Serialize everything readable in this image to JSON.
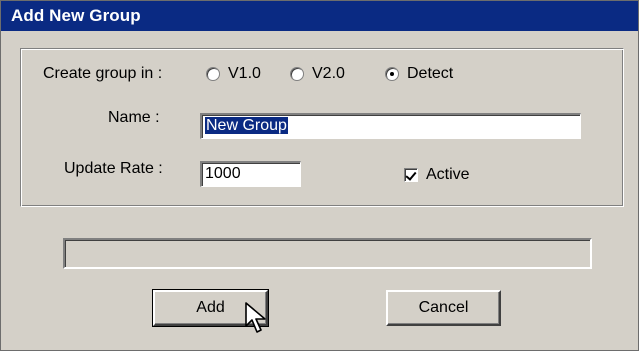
{
  "window": {
    "title": "Add New Group"
  },
  "form": {
    "create_group_label": "Create group in :",
    "radio_options": [
      {
        "label": "V1.0",
        "selected": false
      },
      {
        "label": "V2.0",
        "selected": false
      },
      {
        "label": "Detect",
        "selected": true
      }
    ],
    "name_label": "Name :",
    "name_value": "New Group",
    "update_rate_label": "Update Rate :",
    "update_rate_value": "1000",
    "active_label": "Active",
    "active_checked": true
  },
  "progress": {
    "value": 0
  },
  "buttons": {
    "add_label": "Add",
    "cancel_label": "Cancel"
  },
  "colors": {
    "titlebar": "#0a2a83",
    "dialog": "#d4d0c8",
    "selection": "#0a2a83"
  },
  "icons": {
    "cursor": "arrow-cursor-icon"
  }
}
